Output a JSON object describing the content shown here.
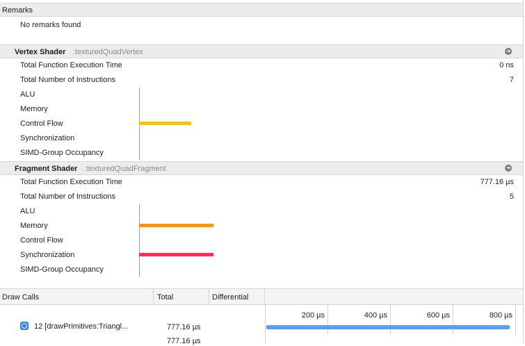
{
  "remarks": {
    "title": "Remarks",
    "message": "No remarks found"
  },
  "vertex_shader": {
    "title": "Vertex Shader",
    "function_name": ":texturedQuadVertex",
    "rows": [
      {
        "label": "Total Function Execution Time",
        "value": "0 ns"
      },
      {
        "label": "Total Number of Instructions",
        "value": "7"
      }
    ],
    "metrics": [
      {
        "label": "ALU",
        "fraction": 0
      },
      {
        "label": "Memory",
        "fraction": 0
      },
      {
        "label": "Control Flow",
        "fraction": 0.14,
        "color": "#f8c400"
      },
      {
        "label": "Synchronization",
        "fraction": 0
      },
      {
        "label": "SIMD-Group Occupancy",
        "fraction": 0
      }
    ]
  },
  "fragment_shader": {
    "title": "Fragment Shader",
    "function_name": ":texturedQuadFragment",
    "rows": [
      {
        "label": "Total Function Execution Time",
        "value": "777.16 µs"
      },
      {
        "label": "Total Number of Instructions",
        "value": "5"
      }
    ],
    "metrics": [
      {
        "label": "ALU",
        "fraction": 0
      },
      {
        "label": "Memory",
        "fraction": 0.2,
        "color": "#ff9500"
      },
      {
        "label": "Control Flow",
        "fraction": 0
      },
      {
        "label": "Synchronization",
        "fraction": 0.2,
        "color": "#ff2d55"
      },
      {
        "label": "SIMD-Group Occupancy",
        "fraction": 0
      }
    ]
  },
  "draw_calls": {
    "columns": {
      "name": "Draw Calls",
      "total": "Total",
      "differential": "Differential"
    },
    "timeline_ticks": [
      "200 µs",
      "400 µs",
      "600 µs",
      "800 µs"
    ],
    "rows": [
      {
        "label": "12 [drawPrimitives:Triangl...",
        "total": "777.16 µs",
        "duration_us": 777.16,
        "bar_color": "#5d9cf5"
      },
      {
        "label": "",
        "total": "777.16 µs"
      }
    ]
  }
}
